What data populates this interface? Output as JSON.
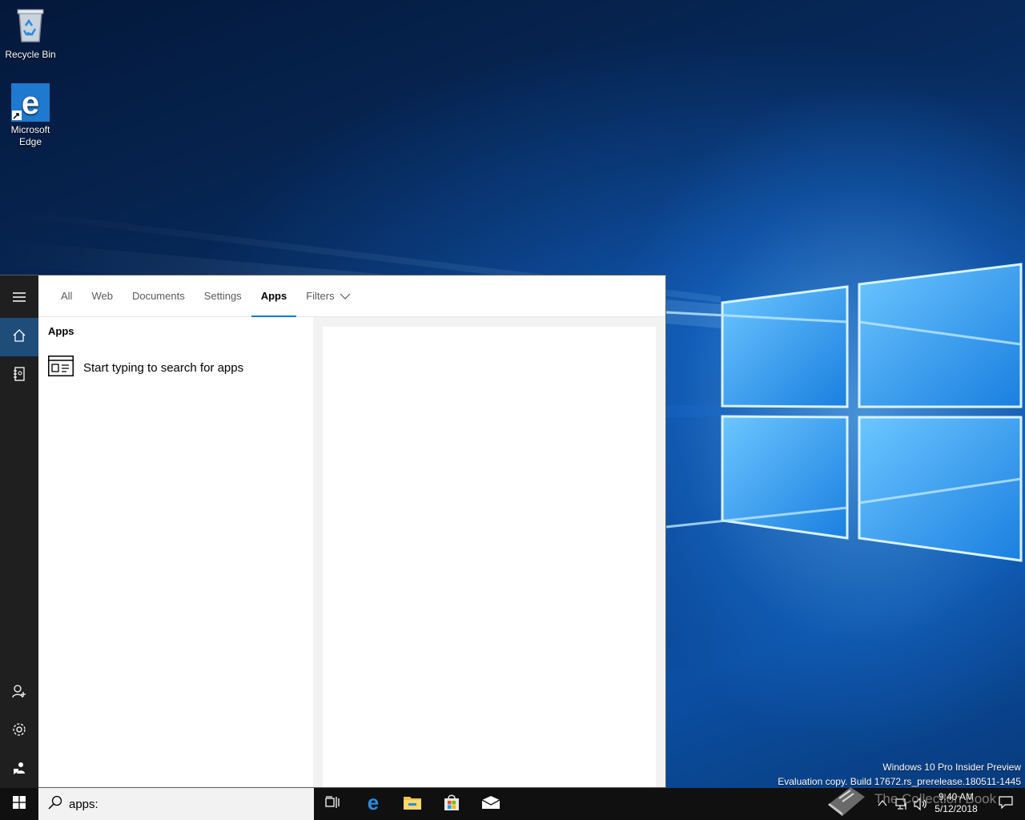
{
  "desktop": {
    "icons": [
      {
        "label": "Recycle Bin",
        "icon": "recycle-bin-icon"
      },
      {
        "label": "Microsoft Edge",
        "icon": "edge-icon"
      }
    ],
    "watermark": {
      "line1": "Windows 10 Pro Insider Preview",
      "line2": "Evaluation copy. Build 17672.rs_prerelease.180511-1445"
    }
  },
  "search_panel": {
    "rail": [
      {
        "name": "hamburger-menu",
        "icon": "hamburger-icon"
      },
      {
        "name": "home",
        "icon": "home-icon",
        "active": true
      },
      {
        "name": "notebook",
        "icon": "notebook-icon"
      },
      {
        "name": "account",
        "icon": "person-add-icon"
      },
      {
        "name": "settings",
        "icon": "gear-icon"
      },
      {
        "name": "feedback",
        "icon": "feedback-icon"
      }
    ],
    "tabs": [
      {
        "label": "All"
      },
      {
        "label": "Web"
      },
      {
        "label": "Documents"
      },
      {
        "label": "Settings"
      },
      {
        "label": "Apps",
        "active": true
      },
      {
        "label": "Filters",
        "has_chevron": true
      }
    ],
    "results": {
      "header": "Apps",
      "items": [
        {
          "label": "Start typing to search for apps",
          "icon": "app-window-icon"
        }
      ]
    }
  },
  "taskbar": {
    "search_value": "apps:",
    "pinned": [
      {
        "name": "task-view",
        "icon": "task-view-icon"
      },
      {
        "name": "edge",
        "icon": "edge-icon"
      },
      {
        "name": "file-explorer",
        "icon": "folder-icon"
      },
      {
        "name": "store",
        "icon": "store-icon"
      },
      {
        "name": "mail",
        "icon": "mail-icon"
      }
    ],
    "clock": {
      "time": "9:40 AM",
      "date": "5/12/2018"
    },
    "overlay_text": "The Collection Book",
    "colors": {
      "accent": "#0078d7",
      "taskbar": "#101010",
      "rail": "#1f1f1f"
    }
  }
}
